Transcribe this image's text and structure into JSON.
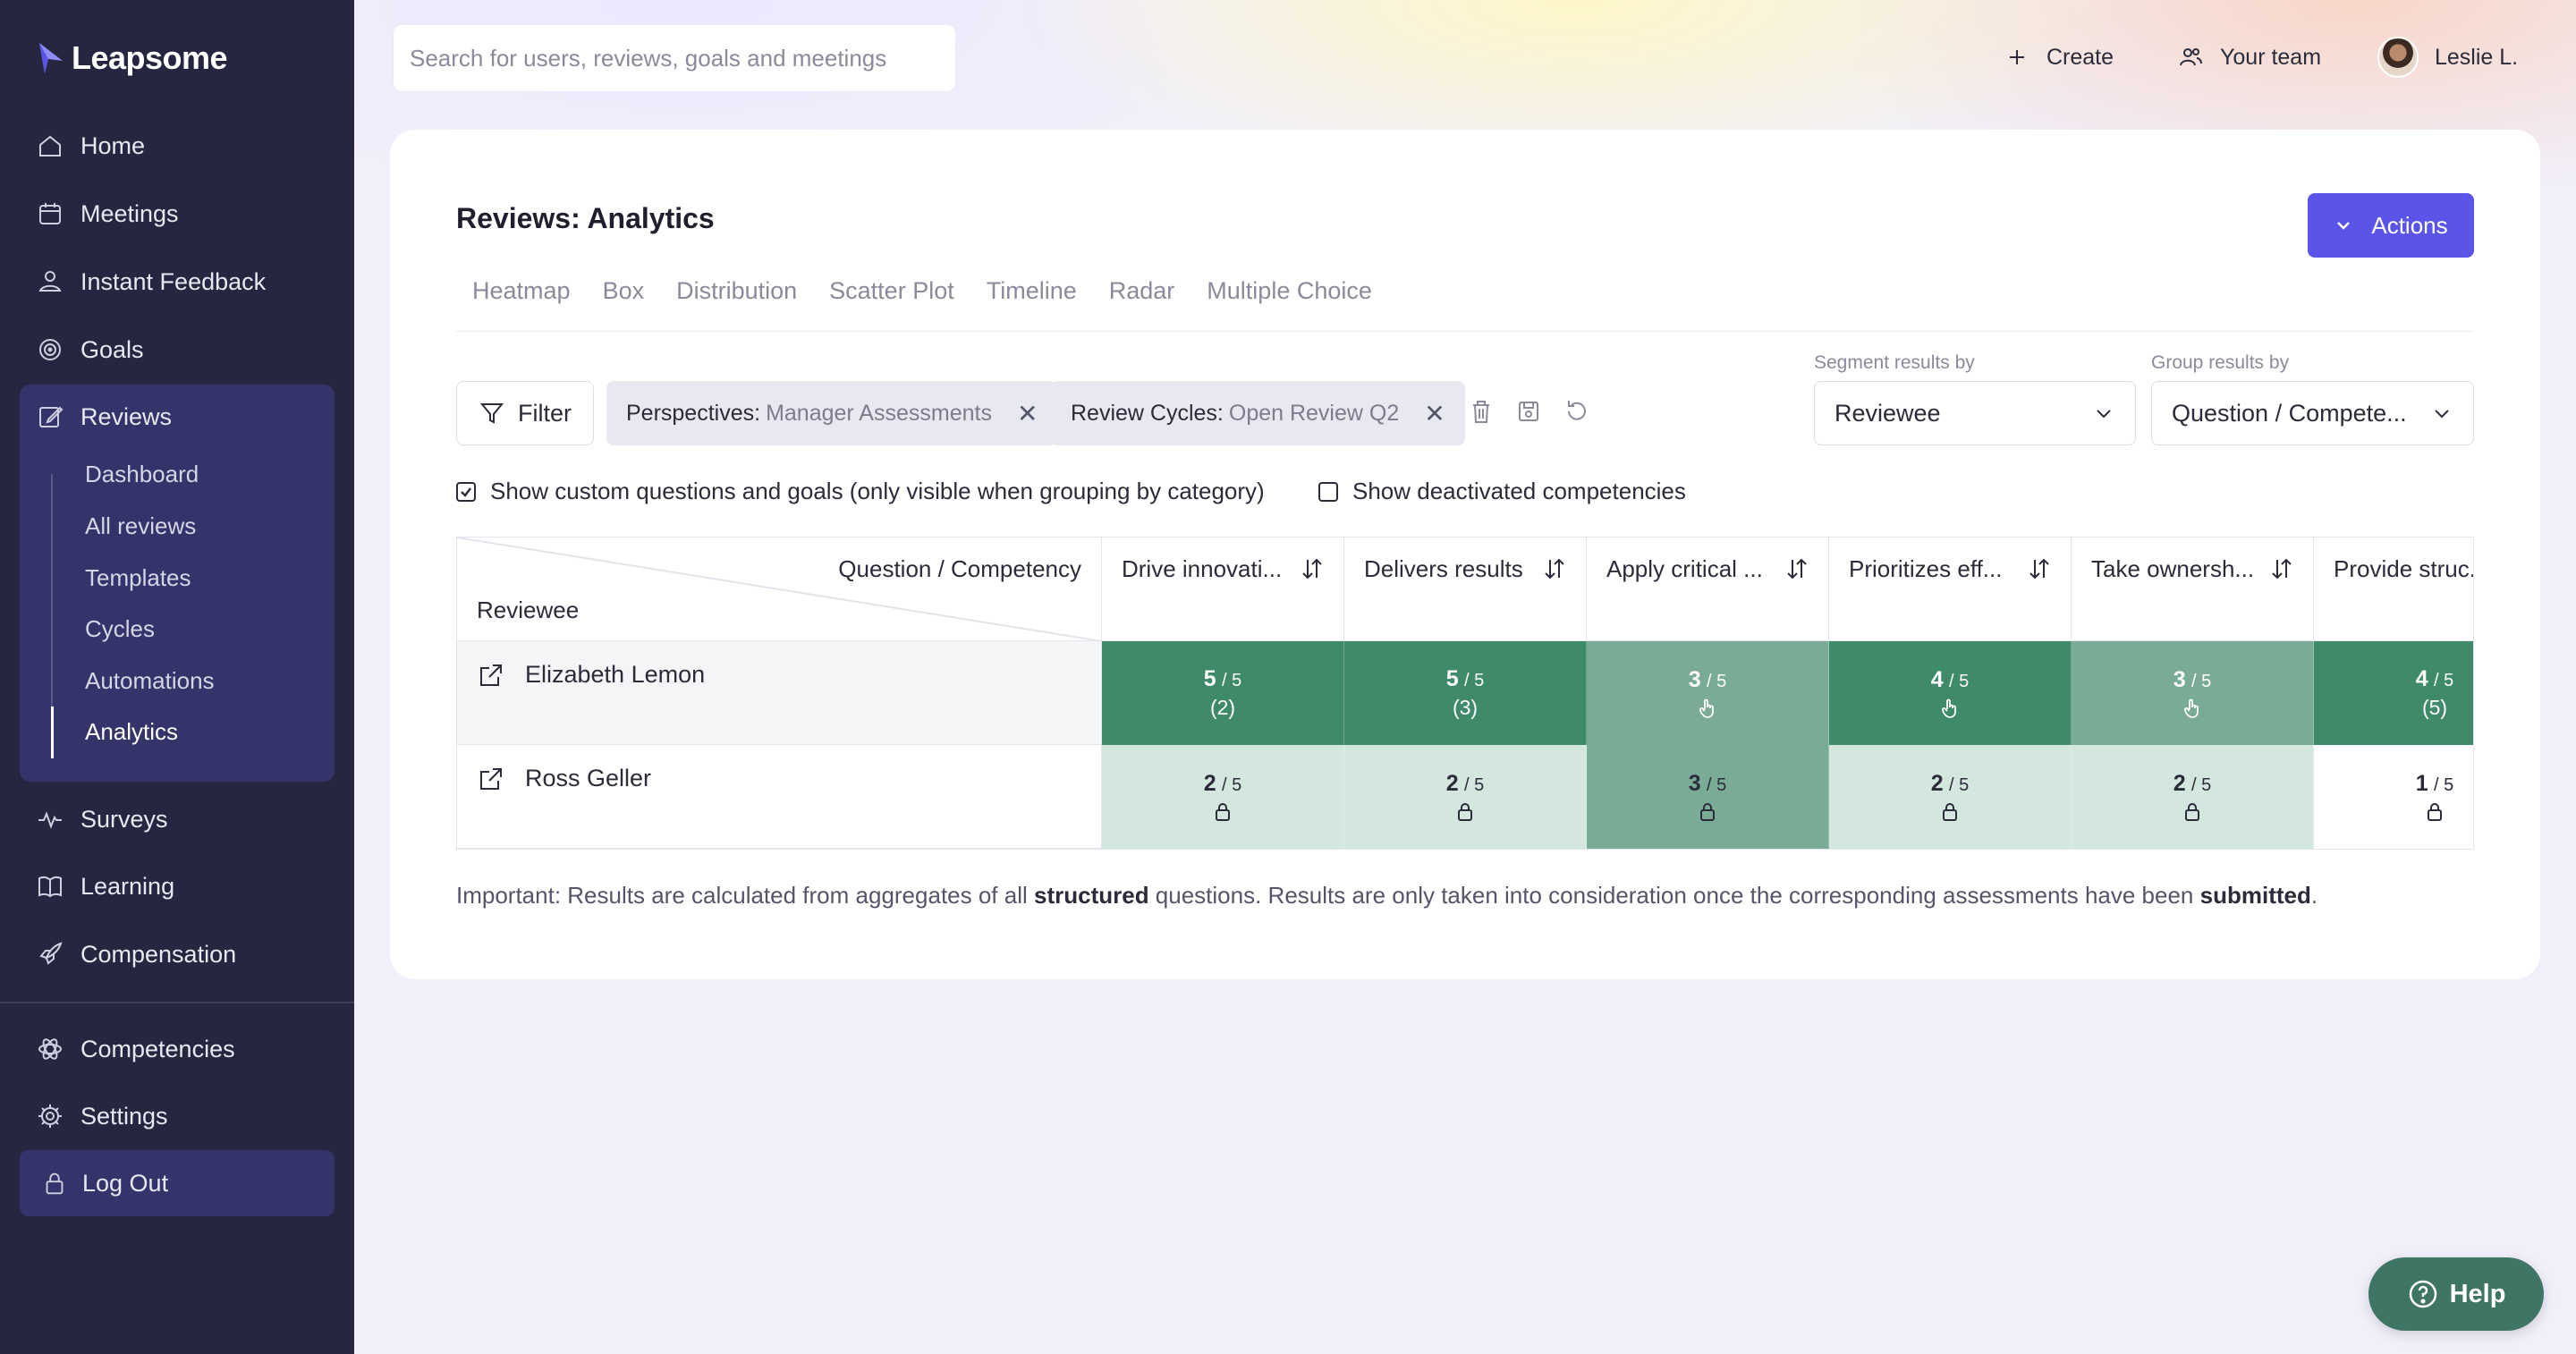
{
  "app": {
    "brand": "Leapsome"
  },
  "sidebar": {
    "items": [
      {
        "label": "Home",
        "icon": "home-icon"
      },
      {
        "label": "Meetings",
        "icon": "calendar-icon"
      },
      {
        "label": "Instant Feedback",
        "icon": "feedback-icon"
      },
      {
        "label": "Goals",
        "icon": "target-icon"
      },
      {
        "label": "Reviews",
        "icon": "edit-icon"
      },
      {
        "label": "Surveys",
        "icon": "pulse-icon"
      },
      {
        "label": "Learning",
        "icon": "book-icon"
      },
      {
        "label": "Compensation",
        "icon": "rocket-icon"
      },
      {
        "label": "Competencies",
        "icon": "atom-icon"
      },
      {
        "label": "Settings",
        "icon": "gear-icon"
      }
    ],
    "reviews_sub": [
      "Dashboard",
      "All reviews",
      "Templates",
      "Cycles",
      "Automations",
      "Analytics"
    ],
    "logout": "Log Out"
  },
  "topbar": {
    "search_placeholder": "Search for users, reviews, goals and meetings",
    "create": "Create",
    "your_team": "Your team",
    "user": "Leslie L."
  },
  "page": {
    "title": "Reviews: Analytics",
    "actions": "Actions",
    "tabs": [
      "Heatmap",
      "Box",
      "Distribution",
      "Scatter Plot",
      "Timeline",
      "Radar",
      "Multiple Choice"
    ],
    "filter": "Filter",
    "chips": [
      {
        "key": "Perspectives:",
        "value": "Manager Assessments"
      },
      {
        "key": "Review Cycles:",
        "value": "Open Review Q2"
      }
    ],
    "segment_label": "Segment results by",
    "segment_value": "Reviewee",
    "group_label": "Group results by",
    "group_value": "Question / Compete...",
    "check1": "Show custom questions and goals (only visible when grouping by category)",
    "check2": "Show deactivated competencies",
    "note_pre": "Important: Results are calculated from aggregates of all ",
    "note_b1": "structured",
    "note_mid": " questions. Results are only taken into consideration once the corresponding assessments have been ",
    "note_b2": "submitted",
    "note_end": ".",
    "help": "Help"
  },
  "table": {
    "corner_col": "Question / Competency",
    "corner_row": "Reviewee",
    "columns": [
      "Drive innovati...",
      "Delivers results",
      "Apply critical ...",
      "Prioritizes eff...",
      "Take ownersh...",
      "Provide struc..."
    ],
    "rows": [
      {
        "name": "Elizabeth Lemon",
        "cells": [
          {
            "score": "5",
            "den": "/ 5",
            "sub": "(2)",
            "icon": "",
            "tone": "dark"
          },
          {
            "score": "5",
            "den": "/ 5",
            "sub": "(3)",
            "icon": "",
            "tone": "dark"
          },
          {
            "score": "3",
            "den": "/ 5",
            "sub": "",
            "icon": "hand-pointer-icon",
            "tone": "mid"
          },
          {
            "score": "4",
            "den": "/ 5",
            "sub": "",
            "icon": "hand-pointer-icon",
            "tone": "dark"
          },
          {
            "score": "3",
            "den": "/ 5",
            "sub": "",
            "icon": "hand-pointer-icon",
            "tone": "mid"
          },
          {
            "score": "4",
            "den": "/ 5",
            "sub": "(5)",
            "icon": "",
            "tone": "dark"
          }
        ]
      },
      {
        "name": "Ross Geller",
        "cells": [
          {
            "score": "2",
            "den": "/ 5",
            "sub": "",
            "icon": "lock-icon",
            "tone": "light"
          },
          {
            "score": "2",
            "den": "/ 5",
            "sub": "",
            "icon": "lock-icon",
            "tone": "light"
          },
          {
            "score": "3",
            "den": "/ 5",
            "sub": "",
            "icon": "lock-icon",
            "tone": "mid"
          },
          {
            "score": "2",
            "den": "/ 5",
            "sub": "",
            "icon": "lock-icon",
            "tone": "light"
          },
          {
            "score": "2",
            "den": "/ 5",
            "sub": "",
            "icon": "lock-icon",
            "tone": "light"
          },
          {
            "score": "1",
            "den": "/ 5",
            "sub": "",
            "icon": "lock-icon",
            "tone": "white"
          }
        ]
      }
    ]
  },
  "colors": {
    "accent": "#5a55e8",
    "sidebar": "#262640",
    "heat_dark": "#3f8a68",
    "heat_mid": "#7aab96",
    "heat_light": "#d4e7de",
    "help": "#3f7565"
  }
}
